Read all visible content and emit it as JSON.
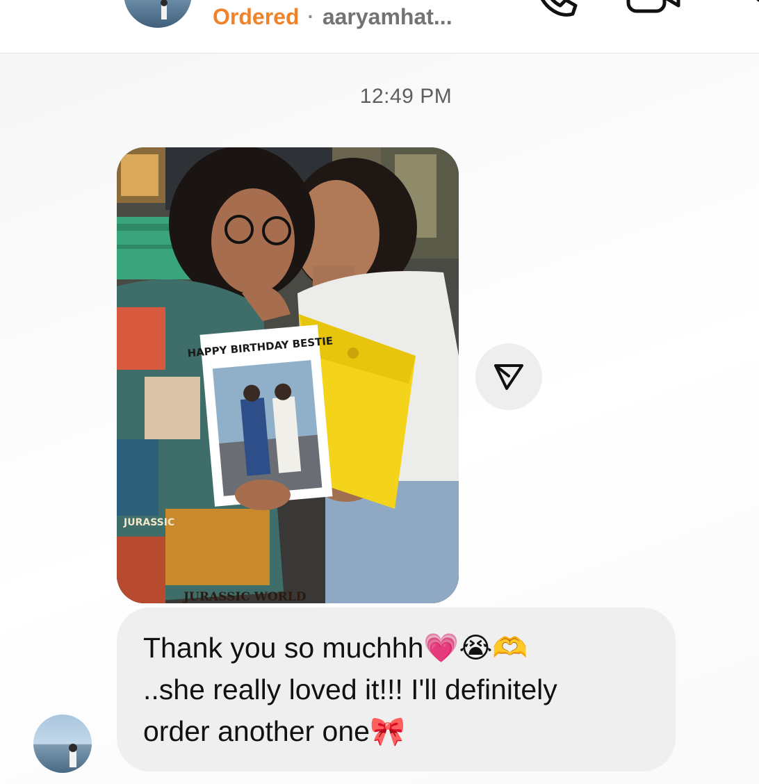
{
  "header": {
    "status_label": "Ordered",
    "separator": "·",
    "username": "aaryamhat..."
  },
  "timestamp": "12:49 PM",
  "photo": {
    "card_caption": "HAPPY BIRTHDAY BESTIE",
    "shirt_labels": [
      "JURASSIC",
      "JURASSIC WORLD"
    ]
  },
  "message": {
    "line1": "Thank you so muchhh💗😭🫶",
    "line2": "..she really loved it!!! I'll definitely",
    "line3": "order another one🎀"
  }
}
